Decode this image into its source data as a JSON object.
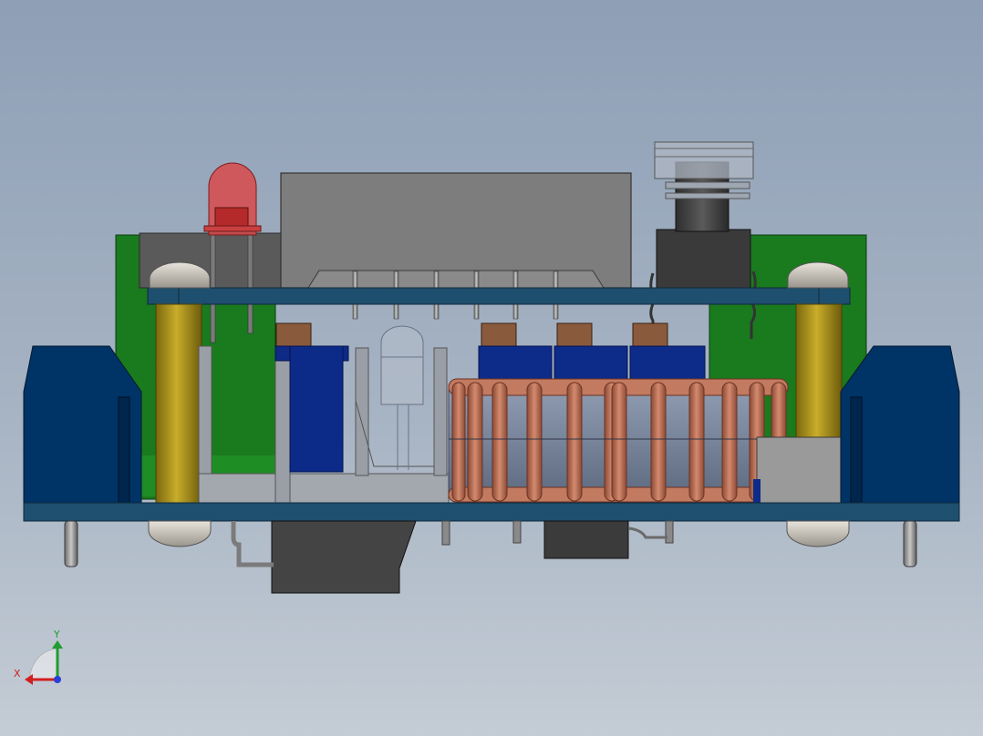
{
  "view": {
    "background_top": "#8e9fb6",
    "background_bottom": "#c4ccd5"
  },
  "triad": {
    "x_label": "X",
    "y_label": "Y",
    "x_color": "#d21f1f",
    "y_color": "#1f9c2f",
    "z_color": "#2a3fd6"
  },
  "colors": {
    "pcb_blue": "#1f4e6e",
    "pcb_green": "#136b18",
    "terminal_blue": "#003366",
    "capacitor_blue": "#0b2a86",
    "brass_standoff": "#a08a1a",
    "copper_coil": "#b86a52",
    "led_red": "#d84848",
    "module_gray": "#7c7c7c",
    "dark_gray": "#404040",
    "heatsink_gray": "#9a9ea6"
  },
  "components": {
    "led": "led-red",
    "module": "relay-module",
    "button": "tactile-button",
    "inductor": "inductor-coil",
    "heatsink": "heatsink"
  }
}
